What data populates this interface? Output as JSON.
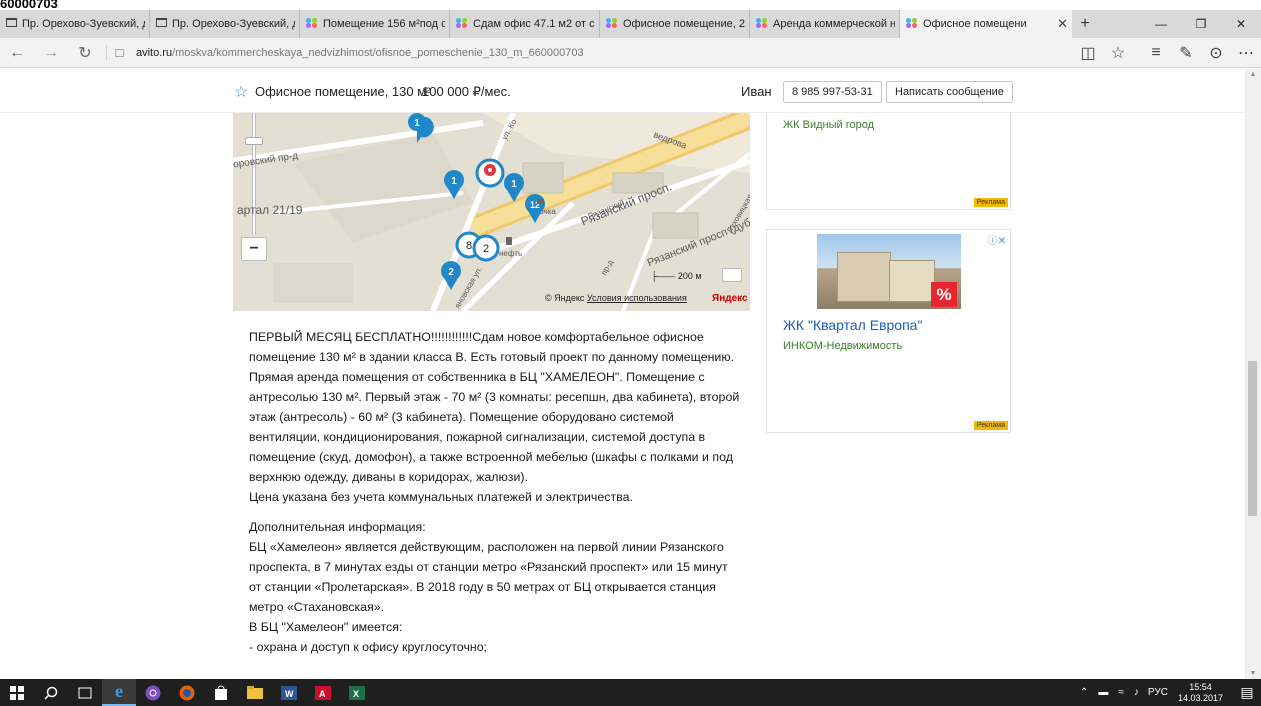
{
  "stray_text": "60000703",
  "browser": {
    "tabs": [
      {
        "title": "Пр. Орехово-Зуевский, д",
        "icon": "window-icon"
      },
      {
        "title": "Пр. Орехово-Зуевский, д",
        "icon": "window-icon"
      },
      {
        "title": "Помещение 156 м²под с",
        "icon": "avito-icon"
      },
      {
        "title": "Сдам офис 47.1 м2 от со",
        "icon": "avito-icon"
      },
      {
        "title": "Офисное помещение, 2З",
        "icon": "avito-icon"
      },
      {
        "title": "Аренда коммерческой н",
        "icon": "avito-icon"
      },
      {
        "title": "Офисное помещени",
        "icon": "avito-icon"
      }
    ],
    "url_domain": "avito.ru",
    "url_path": "/moskva/kommercheskaya_nedvizhimost/ofisnoe_pomeschenie_130_m_660000703",
    "nav_icons": [
      "back-arrow-icon",
      "forward-arrow-icon",
      "refresh-icon",
      "lock-icon"
    ],
    "right_icons": [
      "reading-view-icon",
      "favorite-star-icon",
      "hub-icon",
      "web-note-icon",
      "share-icon",
      "more-icon"
    ]
  },
  "listing": {
    "title": "Офисное помещение, 130 м²",
    "price": "100 000 ₽/мес.",
    "seller": "Иван",
    "phone": "8 985 997-53-31",
    "message_button": "Написать сообщение"
  },
  "map": {
    "labels": {
      "street1": "оровский пр-д",
      "quarter": "артал 21/19",
      "shop": "Точка",
      "prospect": "Рязанский просп.",
      "prospect_side": "Рязанский просп (дублёр)",
      "street_ryaz": "Рязанский",
      "vedrov": "ведрова",
      "fuel": "нефть",
      "lyukh": "Луховицкая",
      "nov": "яновская ул.",
      "pr_d": "пр-д",
      "ulko": "ул. Ко"
    },
    "markers": [
      "1",
      "1",
      "1",
      "12",
      "8",
      "2",
      "2"
    ],
    "scale": "200 м",
    "copyright": "© Яндекс",
    "terms": "Условия использования",
    "logo": "Яндекс"
  },
  "description": {
    "paragraphs": [
      "ПЕРВЫЙ МЕСЯЦ БЕСПЛАТНО!!!!!!!!!!!!Сдам новое комфортабельное офисное помещение 130 м² в здании класса В. Есть готовый проект по данному помещению.",
      "Прямая аренда помещения от собственника в БЦ \"ХАМЕЛЕОН\". Помещение с антресолью 130 м². Первый этаж - 70 м² (3 комнаты: ресепшн, два кабинета), второй этаж (антресоль) - 60 м² (3 кабинета). Помещение оборудовано системой вентиляции, кондиционирования, пожарной сигнализации, системой доступа в помещение (скуд, домофон), а также встроенной мебелью (шкафы с полками и под верхнюю одежду, диваны в коридорах, жалюзи).",
      "Цена указана без учета коммунальных платежей и электричества."
    ],
    "extra_heading": "Дополнительная информация:",
    "extra_paragraphs": [
      "БЦ «Хамелеон» является действующим, расположен на первой линии Рязанского проспекта, в 7 минутах езды от станции метро «Рязанский проспект» или 15 минут от станции «Пролетарская». В 2018 году в 50 метрах от БЦ открывается станция метро «Стахановская».",
      "В БЦ \"Хамелеон\" имеется:",
      "- охрана и доступ к офису круглосуточно;"
    ]
  },
  "ads": [
    {
      "title": "ЖК Видный город",
      "label": "Реклама"
    },
    {
      "title": "ЖК \"Квартал Европа\"",
      "subtitle": "ИНКОМ-Недвижимость",
      "label": "Реклама",
      "badge": "%"
    }
  ],
  "taskbar": {
    "apps": [
      "windows-start-icon",
      "search-icon",
      "task-view-icon",
      "edge-icon",
      "viber-icon",
      "firefox-icon",
      "store-icon",
      "file-explorer-icon",
      "word-icon",
      "acrobat-icon",
      "excel-icon"
    ],
    "lang": "РУС",
    "time": "15:54",
    "date": "14.03.2017"
  }
}
